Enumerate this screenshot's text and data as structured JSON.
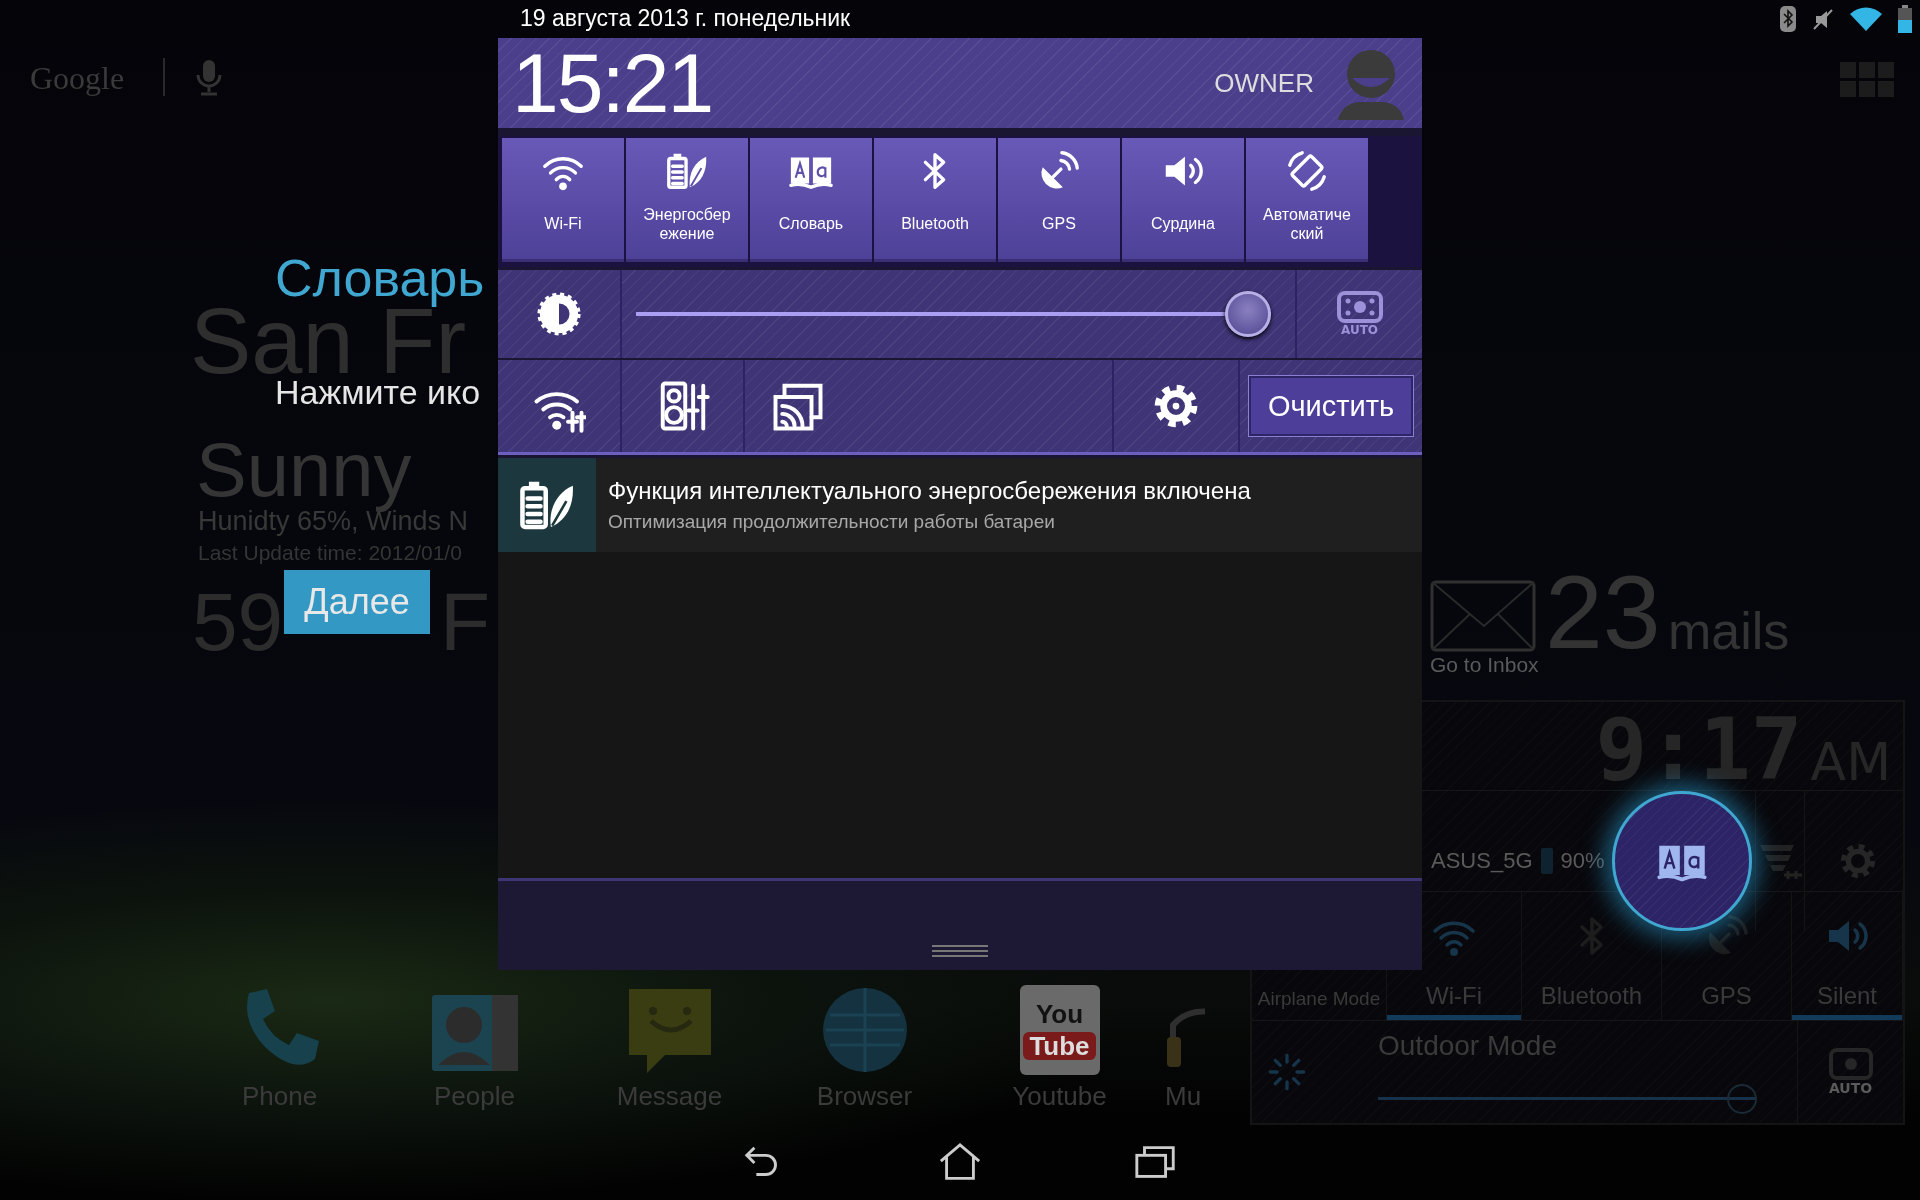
{
  "status_bar": {
    "date": "19 августа 2013 г. понедельник"
  },
  "home": {
    "search": {
      "logo": "Google"
    },
    "tutorial": {
      "title": "Словарь",
      "text": "Нажмите ико",
      "button": "Далее"
    },
    "weather": {
      "city": "San Fr",
      "condition": "Sunny",
      "details": "Hunidty 65%, Winds N",
      "updated": "Last Update time: 2012/01/0",
      "temperature": "59",
      "unit": "F"
    },
    "mail": {
      "count": "23",
      "unit": "mails",
      "link": "Go to Inbox"
    },
    "asus_widget": {
      "time": "9:17",
      "meridiem": "AM",
      "network": "ASUS_5G",
      "battery": "90%",
      "toggles": [
        {
          "label": "Airplane Mode",
          "kind": "airplane",
          "on": false
        },
        {
          "label": "Wi-Fi",
          "kind": "wifi",
          "on": true
        },
        {
          "label": "Bluetooth",
          "kind": "bluetooth",
          "on": false
        },
        {
          "label": "GPS",
          "kind": "gps",
          "on": false
        },
        {
          "label": "Silent",
          "kind": "sound",
          "on": true
        }
      ],
      "outdoor": {
        "label": "Outdoor Mode",
        "level": 1,
        "auto_label": "AUTO"
      }
    },
    "dock": [
      {
        "label": "Phone",
        "kind": "phone"
      },
      {
        "label": "People",
        "kind": "people"
      },
      {
        "label": "Message",
        "kind": "message"
      },
      {
        "label": "Browser",
        "kind": "browser"
      },
      {
        "label": "Youtube",
        "kind": "youtube",
        "logo": [
          "You",
          "Tube"
        ]
      },
      {
        "label": "Mu",
        "kind": "music"
      }
    ]
  },
  "panel": {
    "time": "15:21",
    "user": "OWNER",
    "toggles": [
      {
        "label": "Wi-Fi",
        "kind": "wifi",
        "on": true
      },
      {
        "label": "Энергосбережение",
        "kind": "power",
        "on": true
      },
      {
        "label": "Словарь",
        "kind": "dictionary",
        "on": true
      },
      {
        "label": "Bluetooth",
        "kind": "bluetooth",
        "on": true
      },
      {
        "label": "GPS",
        "kind": "gps",
        "on": true
      },
      {
        "label": "Сурдина",
        "kind": "sound",
        "on": true
      },
      {
        "label": "Автоматический",
        "kind": "rotate",
        "on": true
      }
    ],
    "brightness": {
      "level": 1,
      "auto_label": "AUTO"
    },
    "clear_button": "Очистить",
    "notifications": [
      {
        "title": "Функция интеллектуального энергосбережения включена",
        "text": "Оптимизация продолжительности работы батареи"
      }
    ]
  }
}
